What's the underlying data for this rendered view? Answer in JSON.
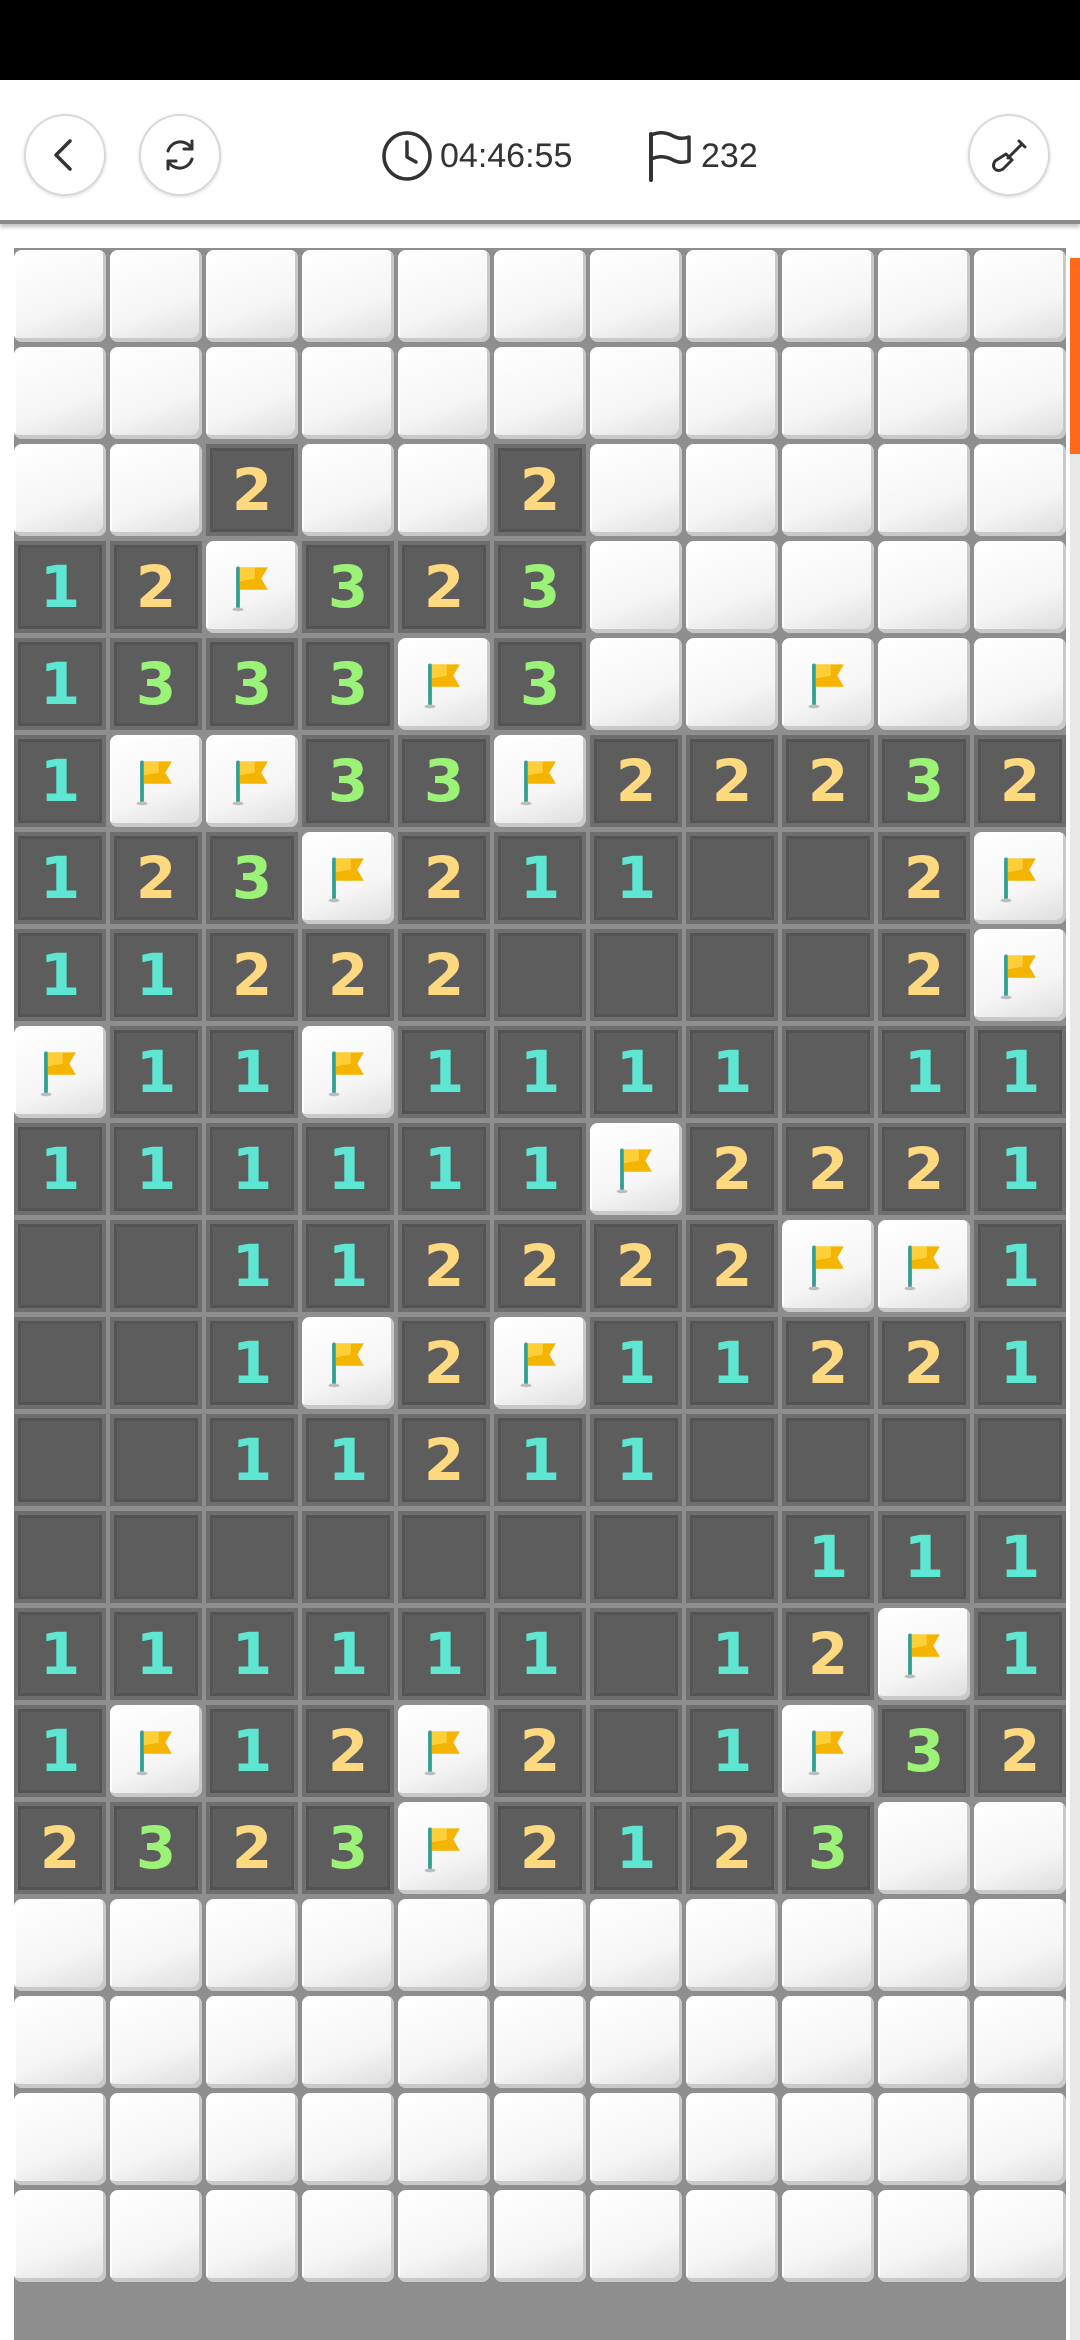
{
  "header": {
    "timer": "04:46:55",
    "flag_count": "232",
    "icons": {
      "back": "chevron-left-icon",
      "restart": "refresh-icon",
      "timer": "clock-icon",
      "flags": "flag-icon",
      "tool": "shovel-icon"
    }
  },
  "board": {
    "columns": 11,
    "rows": [
      [
        "",
        "",
        "",
        "",
        "",
        "",
        "",
        "",
        "",
        "",
        ""
      ],
      [
        "",
        "",
        "",
        "",
        "",
        "",
        "",
        "",
        "",
        "",
        ""
      ],
      [
        "",
        "",
        "2",
        "",
        "",
        "2",
        "",
        "",
        "",
        "",
        ""
      ],
      [
        "1",
        "2",
        "F",
        "3",
        "2",
        "3",
        "",
        "",
        "",
        "",
        ""
      ],
      [
        "1",
        "3",
        "3",
        "3",
        "F",
        "3",
        "",
        "",
        "F",
        "",
        ""
      ],
      [
        "1",
        "F",
        "F",
        "3",
        "3",
        "F",
        "2",
        "2",
        "2",
        "3",
        "2"
      ],
      [
        "1",
        "2",
        "3",
        "F",
        "2",
        "1",
        "1",
        "0",
        "0",
        "2",
        "F"
      ],
      [
        "1",
        "1",
        "2",
        "2",
        "2",
        "0",
        "0",
        "0",
        "0",
        "2",
        "F"
      ],
      [
        "F",
        "1",
        "1",
        "F",
        "1",
        "1",
        "1",
        "1",
        "0",
        "1",
        "1"
      ],
      [
        "1",
        "1",
        "1",
        "1",
        "1",
        "1",
        "F",
        "2",
        "2",
        "2",
        "1"
      ],
      [
        "0",
        "0",
        "1",
        "1",
        "2",
        "2",
        "2",
        "2",
        "F",
        "F",
        "1"
      ],
      [
        "0",
        "0",
        "1",
        "F",
        "2",
        "F",
        "1",
        "1",
        "2",
        "2",
        "1"
      ],
      [
        "0",
        "0",
        "1",
        "1",
        "2",
        "1",
        "1",
        "0",
        "0",
        "0",
        "0"
      ],
      [
        "0",
        "0",
        "0",
        "0",
        "0",
        "0",
        "0",
        "0",
        "1",
        "1",
        "1"
      ],
      [
        "1",
        "1",
        "1",
        "1",
        "1",
        "1",
        "0",
        "1",
        "2",
        "F",
        "1"
      ],
      [
        "1",
        "F",
        "1",
        "2",
        "F",
        "2",
        "0",
        "1",
        "F",
        "3",
        "2"
      ],
      [
        "2",
        "3",
        "2",
        "3",
        "F",
        "2",
        "1",
        "2",
        "3",
        "",
        ""
      ],
      [
        "",
        "",
        "",
        "",
        "",
        "",
        "",
        "",
        "",
        "",
        ""
      ],
      [
        "",
        "",
        "",
        "",
        "",
        "",
        "",
        "",
        "",
        "",
        ""
      ],
      [
        "",
        "",
        "",
        "",
        "",
        "",
        "",
        "",
        "",
        "",
        ""
      ],
      [
        "",
        "",
        "",
        "",
        "",
        "",
        "",
        "",
        "",
        "",
        ""
      ]
    ],
    "legend": {
      "closed": "",
      "open_empty": "0",
      "flag": "F"
    }
  },
  "colors": {
    "number_1": "#5de6d2",
    "number_2": "#ffd980",
    "number_3": "#9cf277",
    "flag": "#f4b400",
    "open_cell": "#5d5d5d",
    "scroll_accent": "#ff6a1a"
  }
}
